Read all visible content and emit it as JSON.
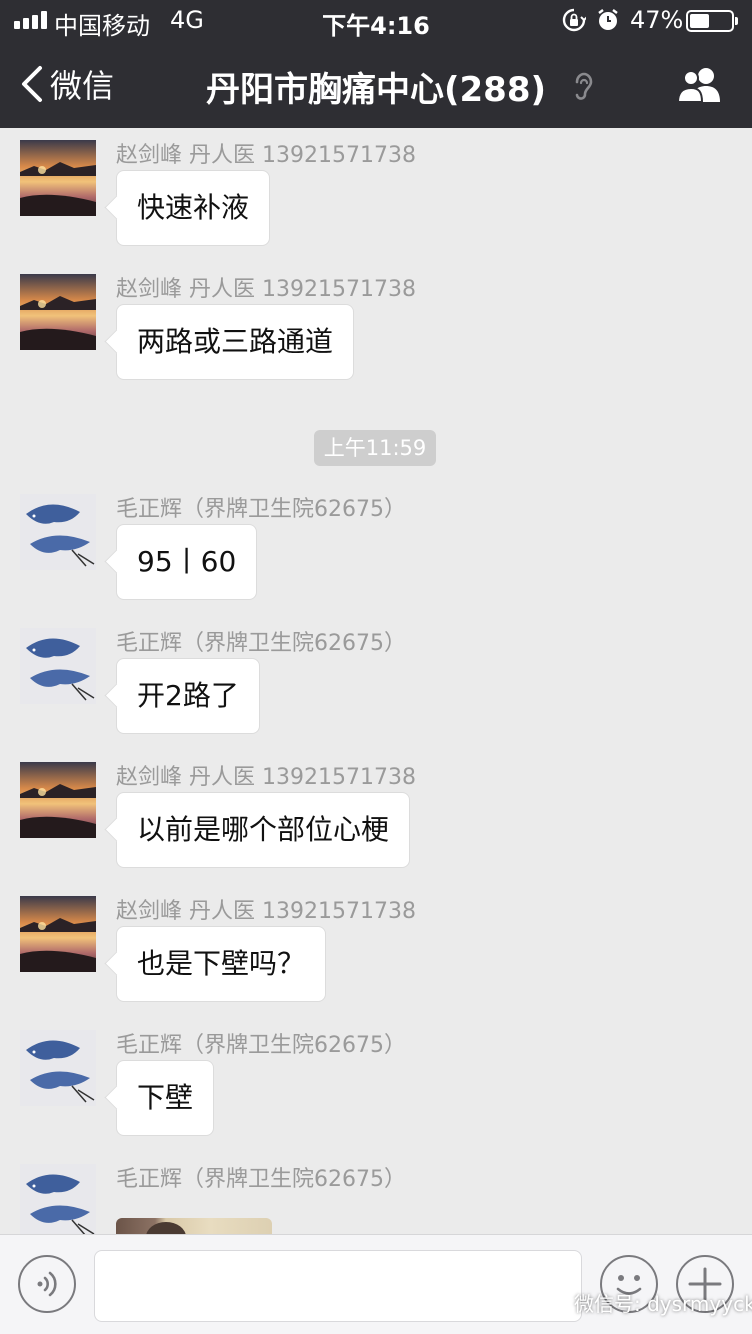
{
  "status_bar": {
    "carrier": "中国移动",
    "network": "4G",
    "time": "下午4:16",
    "battery_percent_text": "47%",
    "battery_level": 0.47,
    "signal_bars": 4
  },
  "nav": {
    "back_label": "微信",
    "title": "丹阳市胸痛中心(288)"
  },
  "chat": {
    "timestamp": "上午11:59",
    "messages": [
      {
        "sender": "赵剑峰  丹人医 13921571738",
        "text": "快速补液",
        "avatar": "sunset"
      },
      {
        "sender": "赵剑峰  丹人医 13921571738",
        "text": "两路或三路通道",
        "avatar": "sunset"
      },
      {
        "sender": "毛正辉（界牌卫生院62675）",
        "text": "95丨60",
        "avatar": "fish"
      },
      {
        "sender": "毛正辉（界牌卫生院62675）",
        "text": "开2路了",
        "avatar": "fish"
      },
      {
        "sender": "赵剑峰  丹人医 13921571738",
        "text": "以前是哪个部位心梗",
        "avatar": "sunset"
      },
      {
        "sender": "赵剑峰  丹人医 13921571738",
        "text": "也是下壁吗？",
        "avatar": "sunset"
      },
      {
        "sender": "毛正辉（界牌卫生院62675）",
        "text": "下壁",
        "avatar": "fish"
      },
      {
        "sender": "毛正辉（界牌卫生院62675）",
        "type": "image",
        "avatar": "fish"
      }
    ]
  },
  "watermark": {
    "text": "微信号: dysrmyyck"
  },
  "colors": {
    "header_bg": "#2e2e33",
    "chat_bg": "#ebebeb",
    "bubble_bg": "#ffffff",
    "timestamp_bg": "#cecece",
    "sender_text": "#9a9a9a"
  },
  "icons": [
    "signal-icon",
    "orientation-lock-icon",
    "alarm-icon",
    "battery-icon",
    "back-chevron-icon",
    "earpiece-icon",
    "group-members-icon",
    "voice-icon",
    "emoji-icon",
    "plus-icon",
    "wechat-logo-icon"
  ]
}
